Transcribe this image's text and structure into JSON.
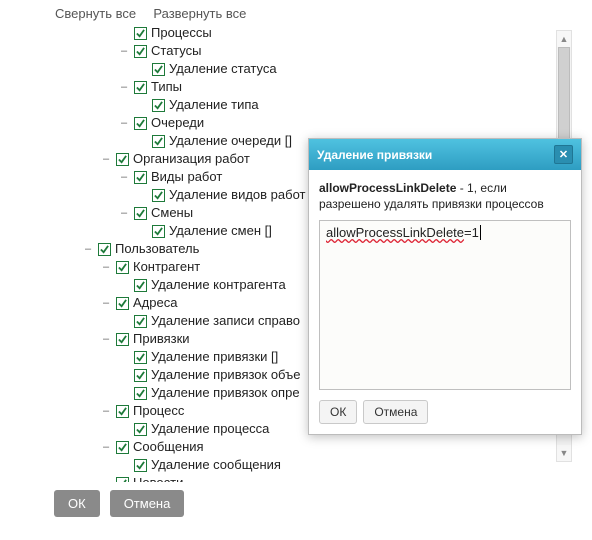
{
  "toolbar": {
    "collapse_all": "Свернуть все",
    "expand_all": "Развернуть все"
  },
  "tree": [
    {
      "depth": 6,
      "toggle": "",
      "checked": true,
      "label": "Процессы"
    },
    {
      "depth": 6,
      "toggle": "–",
      "checked": true,
      "label": "Статусы"
    },
    {
      "depth": 7,
      "toggle": "",
      "checked": true,
      "label": "Удаление статуса"
    },
    {
      "depth": 6,
      "toggle": "–",
      "checked": true,
      "label": "Типы"
    },
    {
      "depth": 7,
      "toggle": "",
      "checked": true,
      "label": "Удаление типа"
    },
    {
      "depth": 6,
      "toggle": "–",
      "checked": true,
      "label": "Очереди"
    },
    {
      "depth": 7,
      "toggle": "",
      "checked": true,
      "label": "Удаление очереди []"
    },
    {
      "depth": 5,
      "toggle": "–",
      "checked": true,
      "label": "Организация работ"
    },
    {
      "depth": 6,
      "toggle": "–",
      "checked": true,
      "label": "Виды работ"
    },
    {
      "depth": 7,
      "toggle": "",
      "checked": true,
      "label": "Удаление видов работ"
    },
    {
      "depth": 6,
      "toggle": "–",
      "checked": true,
      "label": "Смены"
    },
    {
      "depth": 7,
      "toggle": "",
      "checked": true,
      "label": "Удаление смен []"
    },
    {
      "depth": 4,
      "toggle": "–",
      "checked": true,
      "label": "Пользователь"
    },
    {
      "depth": 5,
      "toggle": "–",
      "checked": true,
      "label": "Контрагент"
    },
    {
      "depth": 6,
      "toggle": "",
      "checked": true,
      "label": "Удаление контрагента"
    },
    {
      "depth": 5,
      "toggle": "–",
      "checked": true,
      "label": "Адреса"
    },
    {
      "depth": 6,
      "toggle": "",
      "checked": true,
      "label": "Удаление записи справо"
    },
    {
      "depth": 5,
      "toggle": "–",
      "checked": true,
      "label": "Привязки"
    },
    {
      "depth": 6,
      "toggle": "",
      "checked": true,
      "label": "Удаление привязки []"
    },
    {
      "depth": 6,
      "toggle": "",
      "checked": true,
      "label": "Удаление привязок объе"
    },
    {
      "depth": 6,
      "toggle": "",
      "checked": true,
      "label": "Удаление привязок опре"
    },
    {
      "depth": 5,
      "toggle": "–",
      "checked": true,
      "label": "Процесс"
    },
    {
      "depth": 6,
      "toggle": "",
      "checked": true,
      "label": "Удаление процесса"
    },
    {
      "depth": 5,
      "toggle": "–",
      "checked": true,
      "label": "Сообщения"
    },
    {
      "depth": 6,
      "toggle": "",
      "checked": true,
      "label": "Удаление сообщения"
    },
    {
      "depth": 5,
      "toggle": "–",
      "checked": true,
      "label": "Новости"
    }
  ],
  "buttons": {
    "ok": "ОК",
    "cancel": "Отмена"
  },
  "dialog": {
    "title": "Удаление привязки",
    "desc_key": "allowProcessLinkDelete",
    "desc_text": " - 1, если разрешено удалять привязки процессов",
    "textarea_value": "allowProcessLinkDelete=1",
    "ok": "ОК",
    "cancel": "Отмена"
  }
}
